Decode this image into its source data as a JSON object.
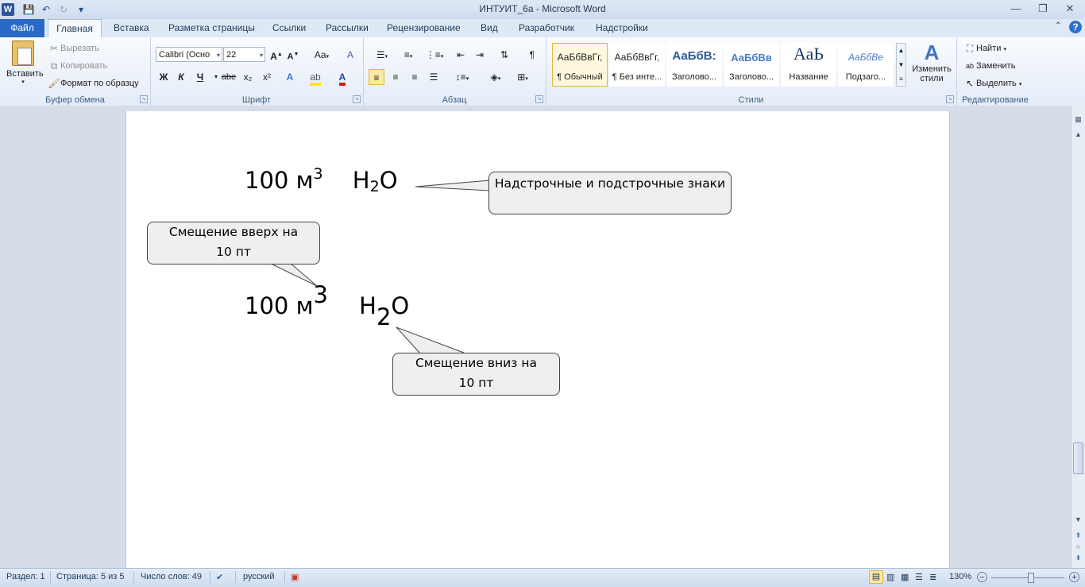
{
  "window": {
    "title": "ИНТУИТ_6а  -  Microsoft Word",
    "app_icon": "W"
  },
  "qat": {
    "save_icon": "💾",
    "undo_icon": "↶",
    "redo_icon": "↻",
    "customize_icon": "▾"
  },
  "window_controls": {
    "minimize": "—",
    "restore": "❐",
    "close": "✕"
  },
  "tabs": [
    "Файл",
    "Главная",
    "Вставка",
    "Разметка страницы",
    "Ссылки",
    "Рассылки",
    "Рецензирование",
    "Вид",
    "Разработчик",
    "Надстройки"
  ],
  "ribbon": {
    "clipboard": {
      "label": "Буфер обмена",
      "paste": "Вставить",
      "cut": "Вырезать",
      "copy": "Копировать",
      "format_painter": "Формат по образцу"
    },
    "font": {
      "label": "Шрифт",
      "font_name": "Calibri (Осно",
      "font_size": "22",
      "bold": "Ж",
      "italic": "К",
      "underline": "Ч",
      "strike": "abe",
      "subscript": "x₂",
      "superscript": "x²",
      "grow": "A",
      "shrink": "A",
      "case": "Aa",
      "clear": "A"
    },
    "paragraph": {
      "label": "Абзац"
    },
    "styles": {
      "label": "Стили",
      "items": [
        {
          "sample": "АаБбВвГг,",
          "name": "¶ Обычный"
        },
        {
          "sample": "АаБбВвГг,",
          "name": "¶ Без инте..."
        },
        {
          "sample": "АаБбВ:",
          "name": "Заголово..."
        },
        {
          "sample": "АаБбВв",
          "name": "Заголово..."
        },
        {
          "sample": "АаЬ",
          "name": "Название"
        },
        {
          "sample": "АаБбВе",
          "name": "Подзаго..."
        }
      ],
      "change_styles": "Изменить стили"
    },
    "editing": {
      "label": "Редактирование",
      "find": "Найти",
      "replace": "Заменить",
      "select": "Выделить"
    }
  },
  "document": {
    "line1": {
      "number": "100",
      "unit": "м",
      "sup": "3",
      "h": "H",
      "sub": "2",
      "o": "O"
    },
    "line2": {
      "number": "100",
      "unit": "м",
      "sup": "3",
      "h": "H",
      "sub": "2",
      "o": "O"
    },
    "callout_top": "Надстрочные и подстрочные знаки",
    "callout_up_line1": "Смещение  вверх на",
    "callout_up_line2": "10 пт",
    "callout_down_line1": "Смещение  вниз на",
    "callout_down_line2": "10 пт"
  },
  "status": {
    "section": "Раздел: 1",
    "page": "Страница: 5 из 5",
    "words": "Число слов: 49",
    "language": "русский",
    "zoom": "130%"
  }
}
